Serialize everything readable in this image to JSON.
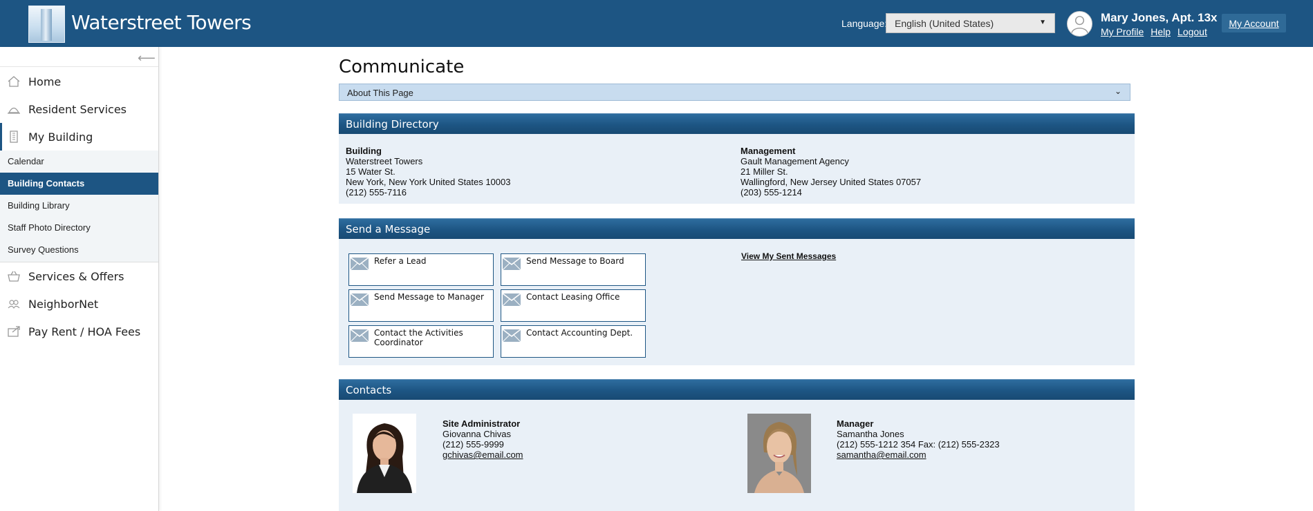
{
  "header": {
    "site_title": "Waterstreet Towers",
    "language_label": "Language:",
    "language_value": "English (United States)",
    "user_name": "Mary Jones, Apt. 13x",
    "links": [
      "My Profile",
      "Help",
      "Logout"
    ],
    "account_button": "My Account",
    "bar_color": "#1d5583"
  },
  "sidebar": {
    "collapse_icon": "arrow-left-icon",
    "items_top": [
      {
        "label": "Home",
        "icon": "home-icon"
      },
      {
        "label": "Resident Services",
        "icon": "concierge-bell-icon"
      },
      {
        "label": "My Building",
        "icon": "building-icon"
      }
    ],
    "subitems": [
      "Calendar",
      "Building Contacts",
      "Building Library",
      "Staff Photo Directory",
      "Survey Questions"
    ],
    "active_subitem": "Building Contacts",
    "items_bottom": [
      {
        "label": "Services & Offers",
        "icon": "basket-icon"
      },
      {
        "label": "NeighborNet",
        "icon": "people-icon"
      },
      {
        "label": "Pay Rent / HOA Fees",
        "icon": "payment-icon"
      }
    ]
  },
  "main": {
    "page_title": "Communicate",
    "about_label": "About This Page",
    "directory": {
      "title": "Building Directory",
      "building": {
        "heading": "Building",
        "name": "Waterstreet Towers",
        "street": "15 Water St.",
        "city": "New York, New York United States 10003",
        "phone": "(212) 555-7116"
      },
      "management": {
        "heading": "Management",
        "name": "Gault Management Agency",
        "street": "21 Miller St.",
        "city": "Wallingford, New Jersey United States 07057",
        "phone": "(203) 555-1214"
      }
    },
    "send_message": {
      "title": "Send a Message",
      "buttons": [
        "Refer a Lead",
        "Send Message to Board",
        "Send Message to Manager",
        "Contact Leasing Office",
        "Contact the Activities Coordinator",
        "Contact Accounting Dept."
      ],
      "sent_link": "View My Sent Messages"
    },
    "contacts": {
      "title": "Contacts",
      "people": [
        {
          "role": "Site Administrator",
          "name": "Giovanna Chivas",
          "phone": "(212) 555-9999",
          "email": "gchivas@email.com"
        },
        {
          "role": "Manager",
          "name": "Samantha Jones",
          "phone": "(212) 555-1212 354  Fax: (212) 555-2323",
          "email": "samantha@email.com"
        }
      ]
    }
  }
}
